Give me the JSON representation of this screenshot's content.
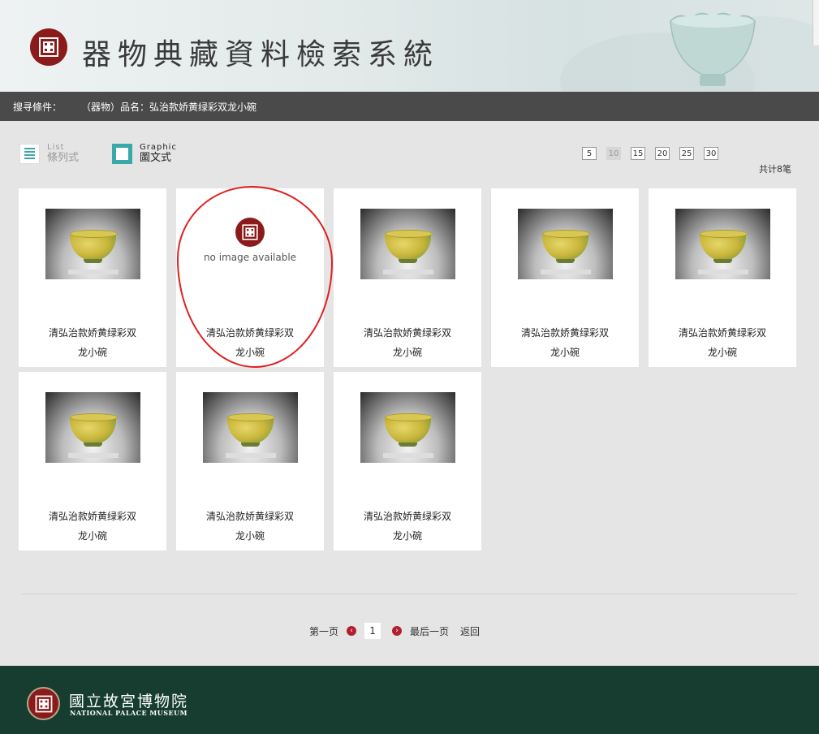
{
  "header": {
    "title": "器物典藏資料檢索系統",
    "logo_icon": "npm-seal-icon"
  },
  "search_condition": {
    "label": "搜寻條件：",
    "value": "（器物）品名：弘治款娇黄绿彩双龙小碗"
  },
  "view_toggle": {
    "list": {
      "en": "List",
      "zh": "條列式"
    },
    "graphic": {
      "en": "Graphic",
      "zh": "圖文式"
    },
    "selected": "graphic"
  },
  "page_sizes": {
    "options": [
      "5",
      "10",
      "15",
      "20",
      "25",
      "30"
    ],
    "selected": "10"
  },
  "total_text": "共计8笔",
  "items": [
    {
      "name_line1": "清弘治款娇黄绿彩双",
      "name_line2": "龙小碗",
      "has_image": true
    },
    {
      "name_line1": "清弘治款娇黄绿彩双",
      "name_line2": "龙小碗",
      "has_image": false,
      "no_image_text": "no image available"
    },
    {
      "name_line1": "清弘治款娇黄绿彩双",
      "name_line2": "龙小碗",
      "has_image": true
    },
    {
      "name_line1": "清弘治款娇黄绿彩双",
      "name_line2": "龙小碗",
      "has_image": true
    },
    {
      "name_line1": "清弘治款娇黄绿彩双",
      "name_line2": "龙小碗",
      "has_image": true
    },
    {
      "name_line1": "清弘治款娇黄绿彩双",
      "name_line2": "龙小碗",
      "has_image": true
    },
    {
      "name_line1": "清弘治款娇黄绿彩双",
      "name_line2": "龙小碗",
      "has_image": true
    },
    {
      "name_line1": "清弘治款娇黄绿彩双",
      "name_line2": "龙小碗",
      "has_image": true
    }
  ],
  "pagination": {
    "first": "第一页",
    "current": "1",
    "last": "最后一页",
    "back": "返回",
    "prev_icon": "chevron-left-icon",
    "next_icon": "chevron-right-icon"
  },
  "footer": {
    "name_zh": "國立故宮博物院",
    "name_en": "NATIONAL PALACE MUSEUM"
  },
  "colors": {
    "accent_teal": "#3aa8a8",
    "seal_red": "#8b1a1a",
    "footer_green": "#163d2f",
    "highlight_red": "#e02020"
  }
}
